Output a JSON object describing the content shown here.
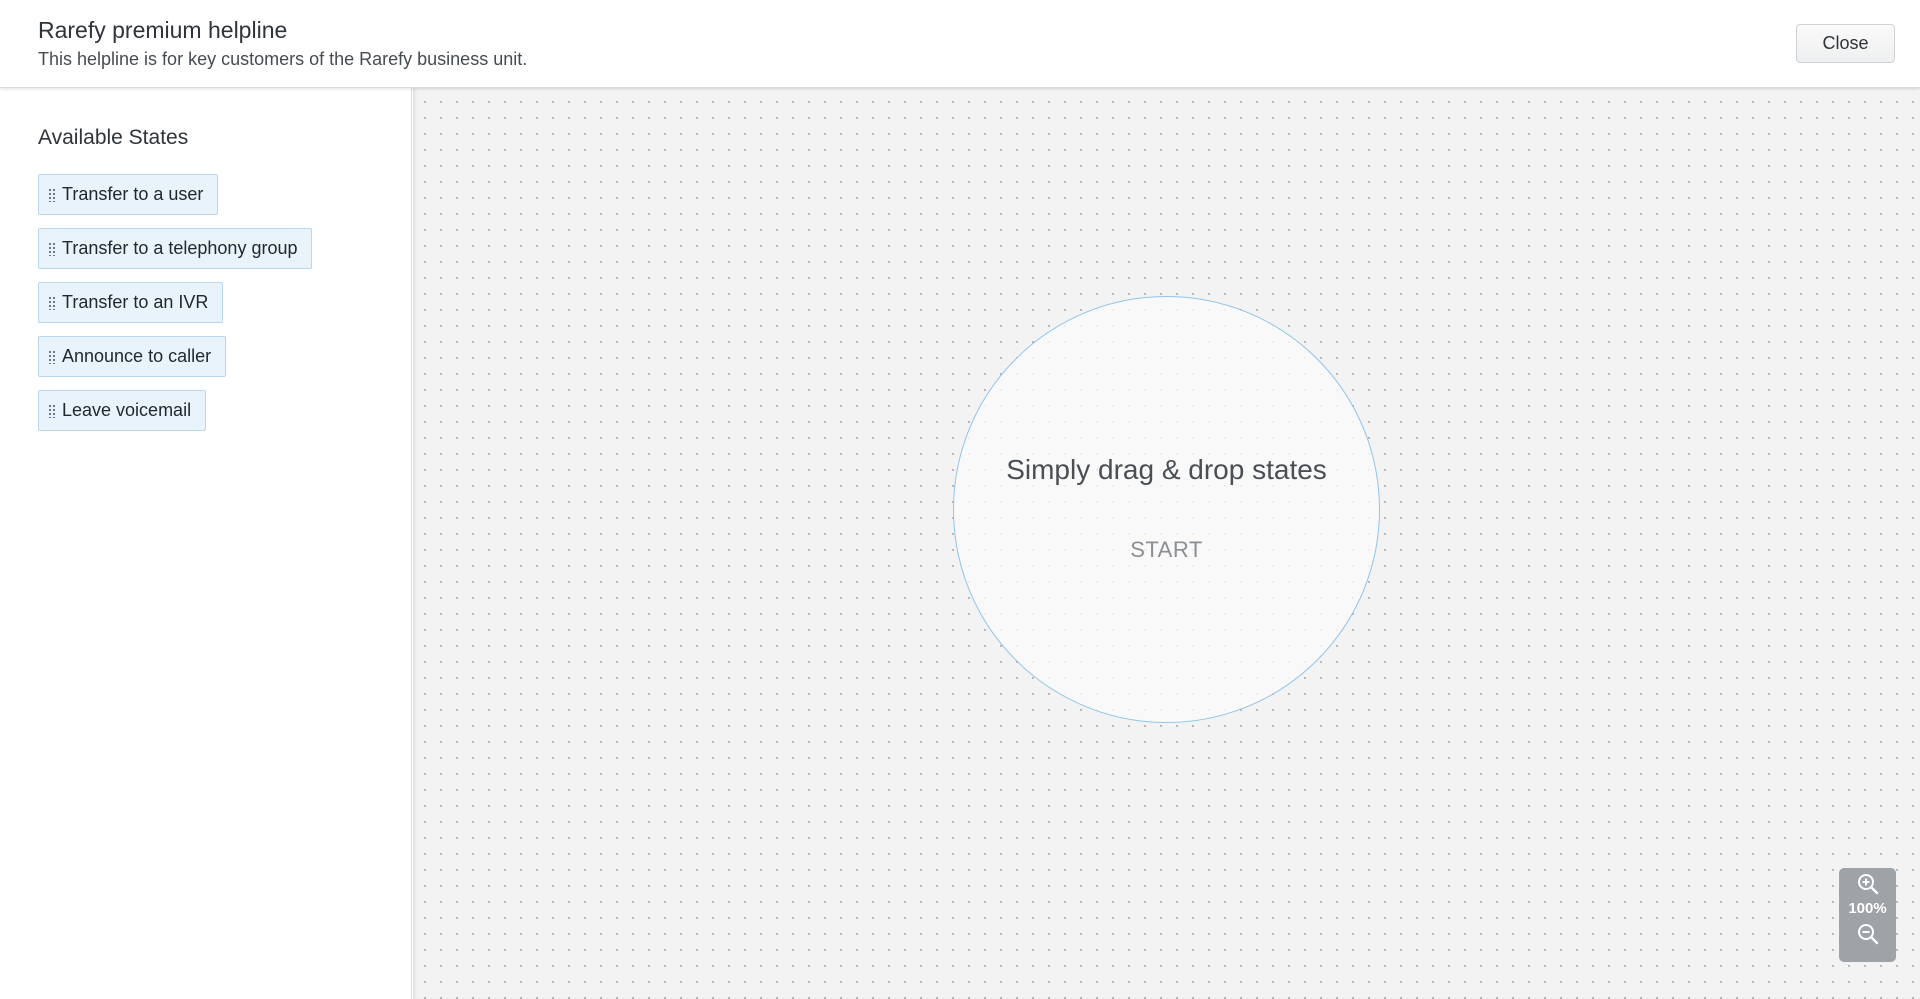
{
  "header": {
    "title": "Rarefy premium helpline",
    "subtitle": "This helpline is for key customers of the Rarefy business unit.",
    "close_label": "Close"
  },
  "sidebar": {
    "heading": "Available States",
    "states": [
      {
        "label": "Transfer to a user"
      },
      {
        "label": "Transfer to a telephony group"
      },
      {
        "label": "Transfer to an IVR"
      },
      {
        "label": "Announce to caller"
      },
      {
        "label": "Leave voicemail"
      }
    ]
  },
  "canvas": {
    "hint": "Simply drag & drop states",
    "start_label": "START"
  },
  "zoom": {
    "level": "100%",
    "zoom_in_icon": "zoom-in-icon",
    "zoom_out_icon": "zoom-out-icon"
  },
  "colors": {
    "accent": "#8cc6ee",
    "state_bg": "#e8f3fb",
    "state_border": "#b9d7ef",
    "canvas_bg": "#f3f3f3",
    "zoom_bg": "#9ea3a8"
  }
}
